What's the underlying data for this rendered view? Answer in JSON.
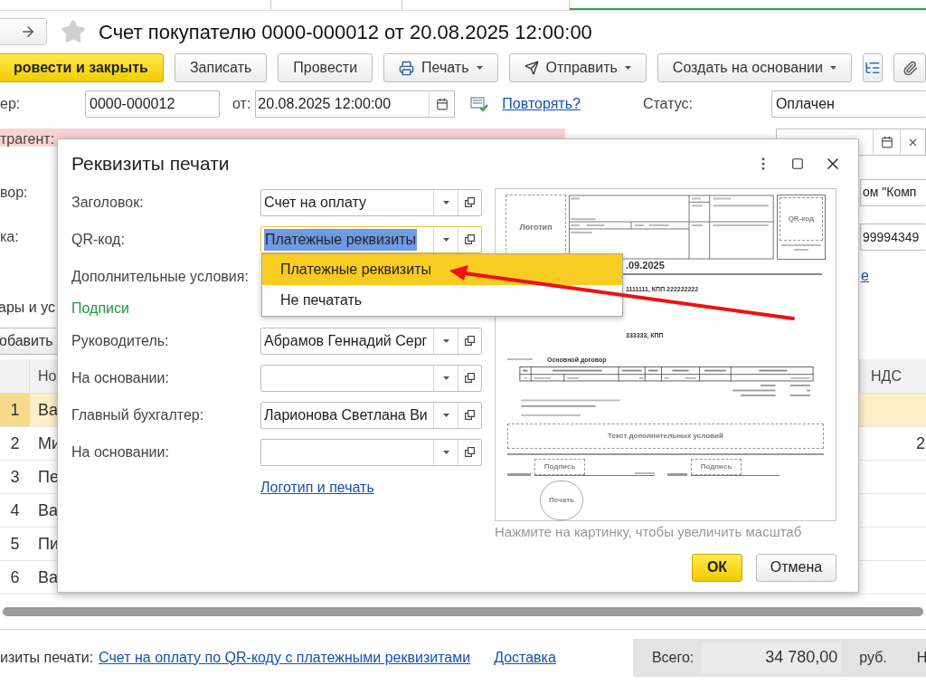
{
  "window": {
    "title": "Счет покупателю 0000-000012 от 20.08.2025 12:00:00"
  },
  "toolbar": [
    {
      "label": "ровести и закрыть",
      "kind": "primary"
    },
    {
      "label": "Записать",
      "kind": "plain"
    },
    {
      "label": "Провести",
      "kind": "plain"
    },
    {
      "label": "Печать",
      "kind": "print"
    },
    {
      "label": "Отправить",
      "kind": "send"
    },
    {
      "label": "Создать на основании",
      "kind": "menu"
    }
  ],
  "header": {
    "number_label": "ер:",
    "number": "0000-000012",
    "date_label": "от:",
    "date": "20.08.2025 12:00:00",
    "repeat_link": "Повторять?",
    "status_label": "Статус:",
    "status": "Оплачен"
  },
  "side_labels": [
    "трагент:",
    "вор:",
    "ка:"
  ],
  "right_fields": [
    {
      "kind": "date"
    },
    {
      "kind": "text",
      "value": "ом \"Комп"
    },
    {
      "kind": "text",
      "value": "99994349"
    },
    {
      "kind": "link",
      "value": "е"
    }
  ],
  "section_tab": "ары и ус",
  "add_button": "обавить",
  "table": {
    "columns": [
      "Но",
      "НДС"
    ],
    "rows": [
      {
        "number": "1",
        "name": "Ва",
        "selected": true
      },
      {
        "number": "2",
        "name": "Ми",
        "vat": "2",
        "selected": false
      },
      {
        "number": "3",
        "name": "Пе",
        "selected": false
      },
      {
        "number": "4",
        "name": "Ва",
        "selected": false
      },
      {
        "number": "5",
        "name": "Пи",
        "selected": false
      },
      {
        "number": "6",
        "name": "Ва",
        "selected": false
      }
    ]
  },
  "footer": {
    "print_label": "изиты печати:",
    "print_link": "Счет на оплату по QR-коду с платежными реквизитами",
    "delivery_link": "Доставка",
    "total_label": "Всего:",
    "total": "34 780,00",
    "currency": "руб.",
    "column_cut": "Н"
  },
  "dialog": {
    "title": "Реквизиты печати",
    "fields": [
      {
        "kind": "combo",
        "label": "Заголовок:",
        "value": "Счет на оплату",
        "focused": false
      },
      {
        "kind": "combo",
        "label": "QR-код:",
        "value": "Платежные реквизиты",
        "focused": true
      },
      {
        "kind": "label",
        "label": "Дополнительные условия:"
      },
      {
        "kind": "heading",
        "label": "Подписи"
      },
      {
        "kind": "combo",
        "label": "Руководитель:",
        "value": "Абрамов Геннадий Серг",
        "focused": false
      },
      {
        "kind": "combo",
        "label": "На основании:",
        "focused": false
      },
      {
        "kind": "combo",
        "label": "Главный бухгалтер:",
        "value": "Ларионова Светлана Ви",
        "focused": false
      },
      {
        "kind": "combo",
        "label": "На основании:",
        "focused": false
      },
      {
        "kind": "link",
        "label": "Логотип и печать"
      }
    ],
    "dropdown": [
      {
        "label": "Платежные реквизиты",
        "selected": true
      },
      {
        "label": "Не печатать",
        "selected": false
      }
    ],
    "preview": {
      "logo": "Логотип",
      "qr": "QR-код",
      "date": ".09.2025",
      "supplier": "1111111, КПП 222222222",
      "buyer": "333333, КПП",
      "basis": "Основной договор",
      "terms": "Текст дополнительных условий",
      "sign_1": "Подпись",
      "sign_2": "Подпись",
      "stamp": "Печать"
    },
    "caption": "Нажмите на картинку, чтобы увеличить масштаб",
    "buttons": [
      {
        "label": "ОК",
        "kind": "primary"
      },
      {
        "label": "Отмена",
        "kind": "plain"
      }
    ]
  }
}
